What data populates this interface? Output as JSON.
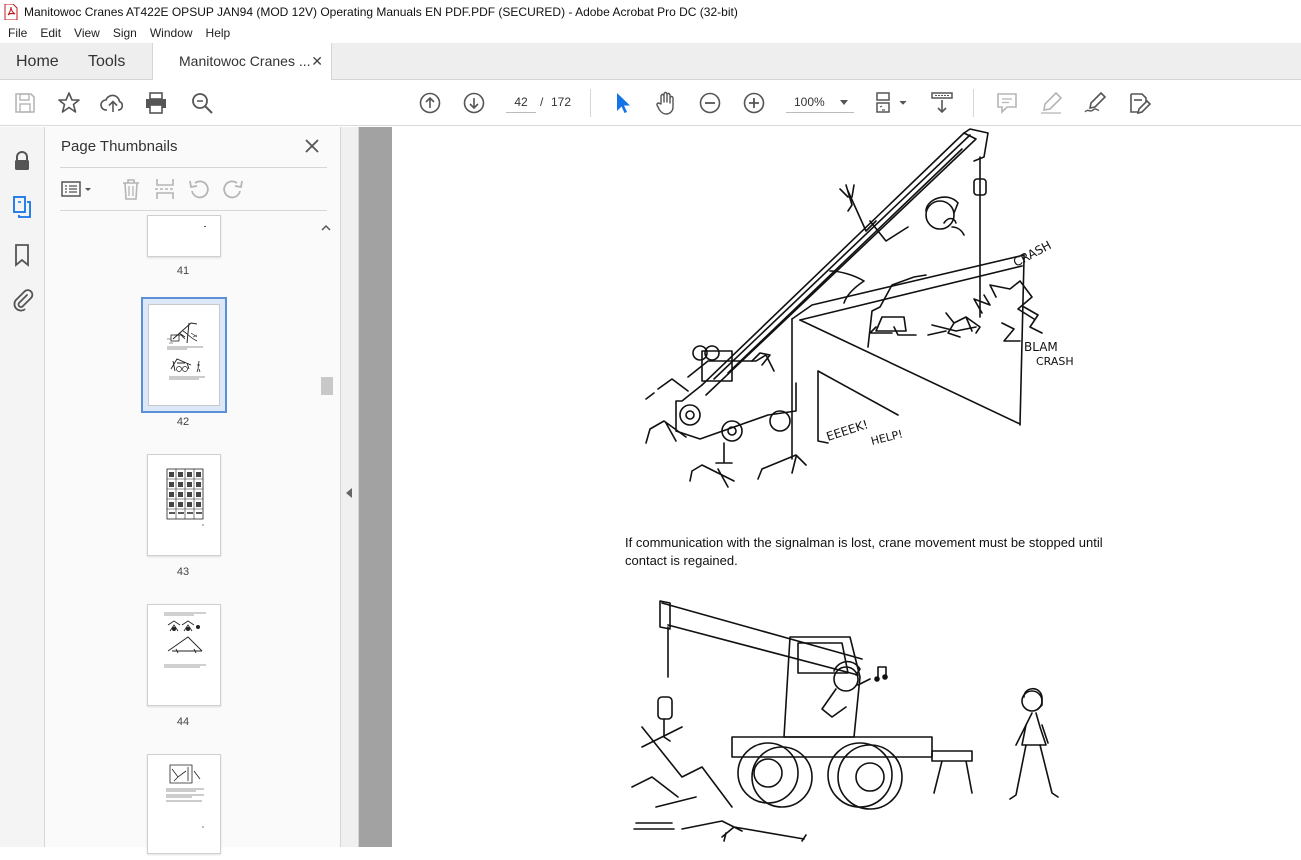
{
  "window": {
    "title": "Manitowoc Cranes AT422E OPSUP JAN94 (MOD 12V) Operating Manuals EN PDF.PDF (SECURED) - Adobe Acrobat Pro DC (32-bit)"
  },
  "menu": [
    "File",
    "Edit",
    "View",
    "Sign",
    "Window",
    "Help"
  ],
  "tabs": {
    "home": "Home",
    "tools": "Tools",
    "document": "Manitowoc Cranes ...",
    "close": "✕"
  },
  "toolbar": {
    "page_current": "42",
    "page_separator": "/",
    "page_total": "172",
    "zoom": "100%"
  },
  "panel": {
    "title": "Page Thumbnails",
    "close": "✕",
    "thumbnails": [
      {
        "label": "41"
      },
      {
        "label": "42",
        "selected": true
      },
      {
        "label": "43"
      },
      {
        "label": "44"
      }
    ]
  },
  "document": {
    "caption": "If communication with the signalman is lost, crane movement must be stopped until contact is regained.",
    "illustration_text": {
      "crash1": "CRASH",
      "blam": "BLAM",
      "crash2": "CRASH",
      "eeeek": "EEEEK!",
      "help": "HELP!"
    }
  },
  "colors": {
    "accent_selection": "#5b8fd6",
    "pdf_red": "#d0021b",
    "select_tool_blue": "#1473e6"
  }
}
